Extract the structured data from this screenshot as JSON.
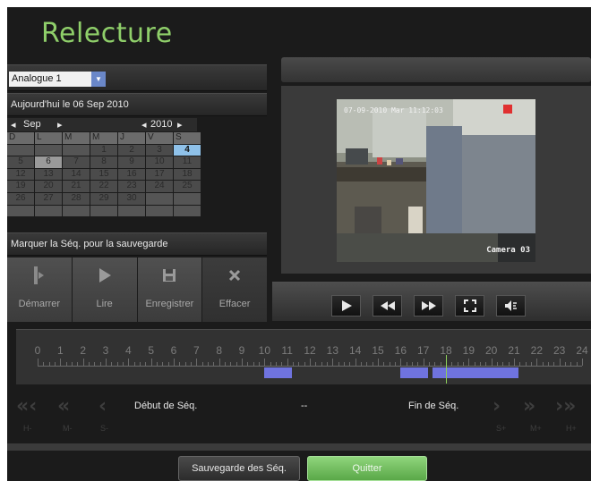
{
  "title": "Relecture",
  "channel_select": {
    "value": "Analogue 1"
  },
  "date_label": "Aujourd'hui le 06 Sep 2010",
  "calendar": {
    "month": "Sep",
    "year": "2010",
    "weekdays": [
      "D",
      "L",
      "M",
      "M",
      "J",
      "V",
      "S"
    ],
    "weeks": [
      [
        "",
        "",
        "",
        "1",
        "2",
        "3",
        "4"
      ],
      [
        "5",
        "6",
        "7",
        "8",
        "9",
        "10",
        "11"
      ],
      [
        "12",
        "13",
        "14",
        "15",
        "16",
        "17",
        "18"
      ],
      [
        "19",
        "20",
        "21",
        "22",
        "23",
        "24",
        "25"
      ],
      [
        "26",
        "27",
        "28",
        "29",
        "30",
        "",
        ""
      ],
      [
        "",
        "",
        "",
        "",
        "",
        "",
        ""
      ]
    ],
    "selected_day": "6",
    "highlight_day": "4"
  },
  "mark_label": "Marquer la Séq. pour la sauvegarde",
  "actions": [
    {
      "label": "Démarrer",
      "icon": "mark-start-icon"
    },
    {
      "label": "Lire",
      "icon": "play-icon"
    },
    {
      "label": "Enregistrer",
      "icon": "save-icon"
    },
    {
      "label": "Effacer",
      "icon": "delete-icon"
    }
  ],
  "video": {
    "timestamp": "07-09-2010 Mar 11:12:03",
    "camera_label": "Camera 03"
  },
  "controls": [
    "play-icon",
    "rewind-icon",
    "fast-forward-icon",
    "fullscreen-icon",
    "volume-icon"
  ],
  "timeline": {
    "hours": [
      "0",
      "1",
      "2",
      "3",
      "4",
      "5",
      "6",
      "7",
      "8",
      "9",
      "10",
      "11",
      "12",
      "13",
      "14",
      "15",
      "16",
      "17",
      "18",
      "19",
      "20",
      "21",
      "22",
      "23",
      "24"
    ],
    "recorded_hours": [
      [
        10,
        11.2
      ],
      [
        16,
        17.2
      ],
      [
        17.4,
        21.2
      ]
    ],
    "cursor_hour": 18,
    "recording_color": "#6f73df",
    "cursor_color": "#8ed05a"
  },
  "nav": {
    "start_label": "Début de Séq.",
    "middle": "--",
    "end_label": "Fin de Séq.",
    "back_hour": "H-",
    "back_min": "M-",
    "back_sec": "S-",
    "fwd_sec": "S+",
    "fwd_min": "M+",
    "fwd_hour": "H+"
  },
  "buttons": {
    "save": "Sauvegarde des Séq.",
    "quit": "Quitter"
  },
  "accent_color": "#8fcf6a"
}
